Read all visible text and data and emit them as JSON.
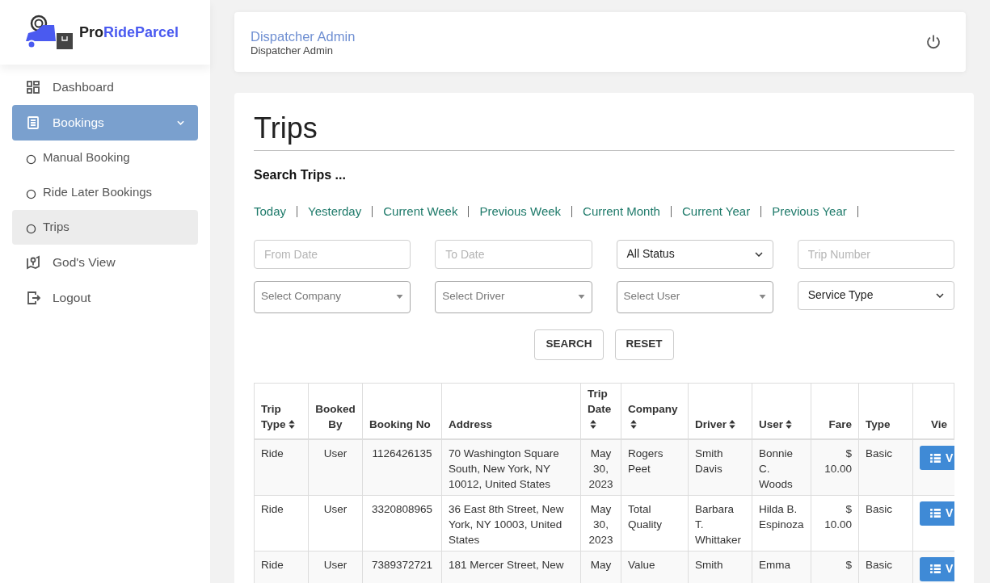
{
  "brand": {
    "prefix": "Pro",
    "suffix": "RideParcel"
  },
  "sidebar": {
    "items": [
      {
        "label": "Dashboard",
        "selected": false
      },
      {
        "label": "Bookings",
        "selected": true,
        "expanded": true,
        "children": [
          {
            "label": "Manual Booking",
            "selected": false
          },
          {
            "label": "Ride Later Bookings",
            "selected": false
          },
          {
            "label": "Trips",
            "selected": true
          }
        ]
      },
      {
        "label": "God's View",
        "selected": false
      },
      {
        "label": "Logout",
        "selected": false
      }
    ]
  },
  "header": {
    "title": "Dispatcher Admin",
    "subtitle": "Dispatcher Admin"
  },
  "page_title": "Trips",
  "search_heading": "Search Trips ...",
  "date_filters": [
    "Today",
    "Yesterday",
    "Current Week",
    "Previous Week",
    "Current Month",
    "Current Year",
    "Previous Year"
  ],
  "filters": [
    {
      "kind": "input",
      "placeholder": "From Date"
    },
    {
      "kind": "input",
      "placeholder": "To Date"
    },
    {
      "kind": "select",
      "value": "All Status"
    },
    {
      "kind": "input",
      "placeholder": "Trip Number"
    },
    {
      "kind": "combo",
      "placeholder": "Select Company"
    },
    {
      "kind": "combo",
      "placeholder": "Select Driver"
    },
    {
      "kind": "combo",
      "placeholder": "Select User"
    },
    {
      "kind": "select",
      "value": "Service Type"
    }
  ],
  "buttons": [
    "SEARCH",
    "RESET"
  ],
  "table": {
    "columns": [
      {
        "label": "Trip Type",
        "sortable": true
      },
      {
        "label": "Booked By",
        "sortable": false
      },
      {
        "label": "Booking No",
        "sortable": false
      },
      {
        "label": "Address",
        "sortable": false
      },
      {
        "label": "Trip Date",
        "sortable": true
      },
      {
        "label": "Company",
        "sortable": true
      },
      {
        "label": "Driver",
        "sortable": true
      },
      {
        "label": "User",
        "sortable": true
      },
      {
        "label": "Fare",
        "sortable": false
      },
      {
        "label": "Type",
        "sortable": false
      },
      {
        "label": "Vie",
        "sortable": false
      }
    ],
    "rows": [
      {
        "cells": [
          "Ride",
          "User",
          "1126426135",
          "70 Washington Square South, New York, NY 10012, United States",
          "May 30, 2023",
          "Rogers Peet",
          "Smith Davis",
          "Bonnie C. Woods",
          "$ 10.00",
          "Basic"
        ],
        "action": "V"
      },
      {
        "cells": [
          "Ride",
          "User",
          "3320808965",
          "36 East 8th Street, New York, NY 10003, United States",
          "May 30, 2023",
          "Total Quality",
          "Barbara T. Whittaker",
          "Hilda B. Espinoza",
          "$ 10.00",
          "Basic"
        ],
        "action": "V"
      },
      {
        "cells": [
          "Ride",
          "User",
          "7389372721",
          "181 Mercer Street, New",
          "May",
          "Value",
          "Smith",
          "Emma",
          "$",
          "Basic"
        ],
        "action": "V"
      }
    ]
  }
}
